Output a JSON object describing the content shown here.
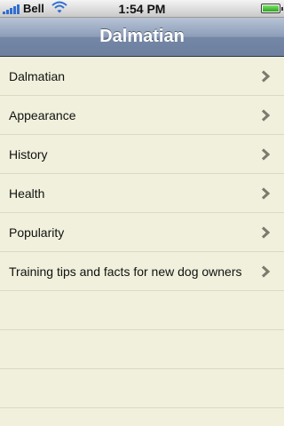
{
  "status_bar": {
    "carrier": "Bell",
    "time": "1:54 PM",
    "signal_bars": 5,
    "battery_level": 1.0,
    "icons": [
      "signal-icon",
      "wifi-icon",
      "battery-icon"
    ]
  },
  "nav": {
    "title": "Dalmatian"
  },
  "list": {
    "items": [
      {
        "label": "Dalmatian"
      },
      {
        "label": "Appearance"
      },
      {
        "label": "History"
      },
      {
        "label": "Health"
      },
      {
        "label": "Popularity"
      },
      {
        "label": "Training tips and facts for new dog owners"
      }
    ],
    "chevron_icon": "chevron-right-icon"
  },
  "colors": {
    "background": "#f0f0dc",
    "nav_gradient_top": "#b7c3d6",
    "nav_gradient_bottom": "#6d7f9f",
    "separator": "#d9d9c4",
    "chevron": "#7a7a6e"
  }
}
